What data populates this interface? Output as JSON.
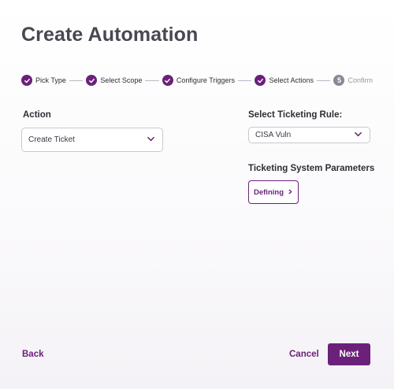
{
  "page": {
    "title": "Create Automation"
  },
  "stepper": {
    "steps": [
      {
        "label": "Pick Type",
        "status": "complete"
      },
      {
        "label": "Select Scope",
        "status": "complete"
      },
      {
        "label": "Configure Triggers",
        "status": "complete"
      },
      {
        "label": "Select Actions",
        "status": "complete"
      },
      {
        "label": "Confirm",
        "status": "pending",
        "number": "5"
      }
    ]
  },
  "action": {
    "label": "Action",
    "selected": "Create Ticket"
  },
  "ticketing_rule": {
    "label": "Select Ticketing Rule:",
    "selected": "CISA Vuln"
  },
  "ticketing_params": {
    "label": "Ticketing System Parameters",
    "button_label": "Defining"
  },
  "footer": {
    "back_label": "Back",
    "cancel_label": "Cancel",
    "next_label": "Next"
  },
  "colors": {
    "accent": "#6b2179",
    "pending_step": "#8c8794"
  }
}
